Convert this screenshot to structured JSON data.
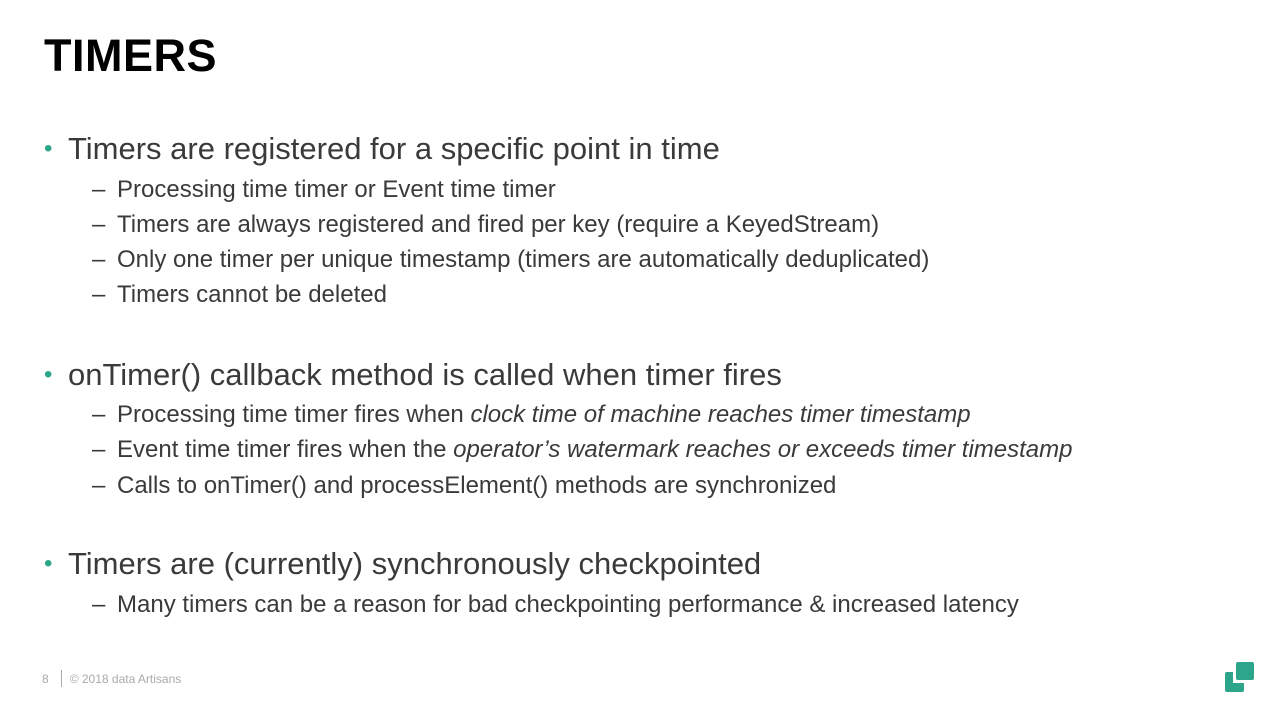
{
  "title": "TIMERS",
  "bullets": [
    {
      "text": "Timers are registered for a specific point in time",
      "subs": [
        [
          {
            "t": "Processing time timer or Event time timer"
          }
        ],
        [
          {
            "t": "Timers are always registered and fired per key (require a KeyedStream)"
          }
        ],
        [
          {
            "t": "Only one timer per unique timestamp (timers are automatically deduplicated)"
          }
        ],
        [
          {
            "t": "Timers cannot be deleted"
          }
        ]
      ]
    },
    {
      "text": "onTimer() callback method is called when timer fires",
      "subs": [
        [
          {
            "t": "Processing time timer fires when "
          },
          {
            "t": "clock time of machine reaches timer timestamp",
            "i": true
          }
        ],
        [
          {
            "t": "Event time timer fires when the "
          },
          {
            "t": "operator’s watermark reaches or exceeds timer timestamp",
            "i": true
          }
        ],
        [
          {
            "t": "Calls to onTimer() and processElement() methods are synchronized"
          }
        ]
      ]
    },
    {
      "text": "Timers are (currently) synchronously checkpointed",
      "subs": [
        [
          {
            "t": "Many timers can be a reason for bad checkpointing performance & increased latency"
          }
        ]
      ]
    }
  ],
  "footer": {
    "page": "8",
    "copyright": "© 2018 data Artisans"
  },
  "colors": {
    "accent": "#2da58a"
  },
  "logo_icon": "data-artisans-logo"
}
